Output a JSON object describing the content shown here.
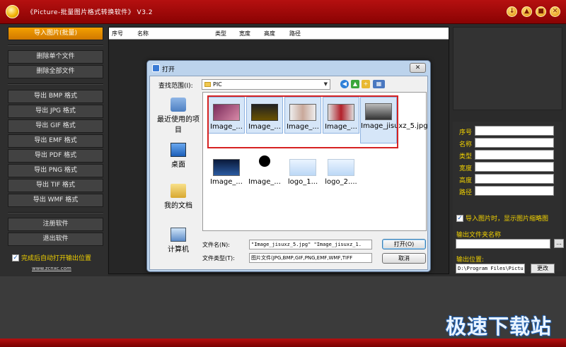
{
  "app": {
    "title": "《Picture-批量图片格式转换软件》 V3.2",
    "window_buttons": [
      "↓",
      "▲",
      "■",
      "✕"
    ]
  },
  "sidebar": {
    "import_label": "导入图片(批量)",
    "delete_one": "删除单个文件",
    "delete_all": "删除全部文件",
    "exports": [
      "导出 BMP 格式",
      "导出 JPG 格式",
      "导出 GIF 格式",
      "导出 EMF 格式",
      "导出 PDF 格式",
      "导出 PNG 格式",
      "导出 TIF 格式",
      "导出 WMF 格式"
    ],
    "register": "注册软件",
    "exit": "退出软件",
    "auto_open_label": "完成后自动打开输出位置",
    "website": "www.zcnxc.com"
  },
  "file_list": {
    "columns": [
      "序号",
      "名称",
      "类型",
      "宽度",
      "高度",
      "路径"
    ]
  },
  "properties": {
    "fields": [
      "序号",
      "名称",
      "类型",
      "宽度",
      "高度",
      "路径"
    ],
    "thumb_label": "导入图片时，显示图片缩略图",
    "output_folder_label": "输出文件夹名称",
    "output_location_label": "输出位置:",
    "output_location_value": "D:\\Program Files\\Pictu",
    "browse_label": "...",
    "change_label": "更改"
  },
  "dialog": {
    "title": "打开",
    "close": "✕",
    "lookin_label": "查找范围(I):",
    "lookin_value": "PIC",
    "places": [
      "最近使用的项目",
      "桌面",
      "我的文档",
      "计算机"
    ],
    "files_row1": [
      "Image_...",
      "Image_...",
      "Image_...",
      "Image_...",
      "Image_jisuxz_5.jpg"
    ],
    "files_row2": [
      "Image_...",
      "Image_...",
      "logo_1...",
      "logo_2...."
    ],
    "filename_label": "文件名(N):",
    "filename_value": "\"Image_jisuxz_5.jpg\" \"Image_jisuxz_1.",
    "filetype_label": "文件类型(T):",
    "filetype_value": "图片文件(JPG,BMP,GIF,PNG,EMF,WMF,TIFF",
    "open_label": "打开(O)",
    "cancel_label": "取消"
  },
  "watermark": "极速下载站",
  "colors": {
    "accent_red": "#a00808",
    "label_yellow": "#f2d200",
    "primary_orange": "#e08c00",
    "selection_red": "#d62222"
  }
}
